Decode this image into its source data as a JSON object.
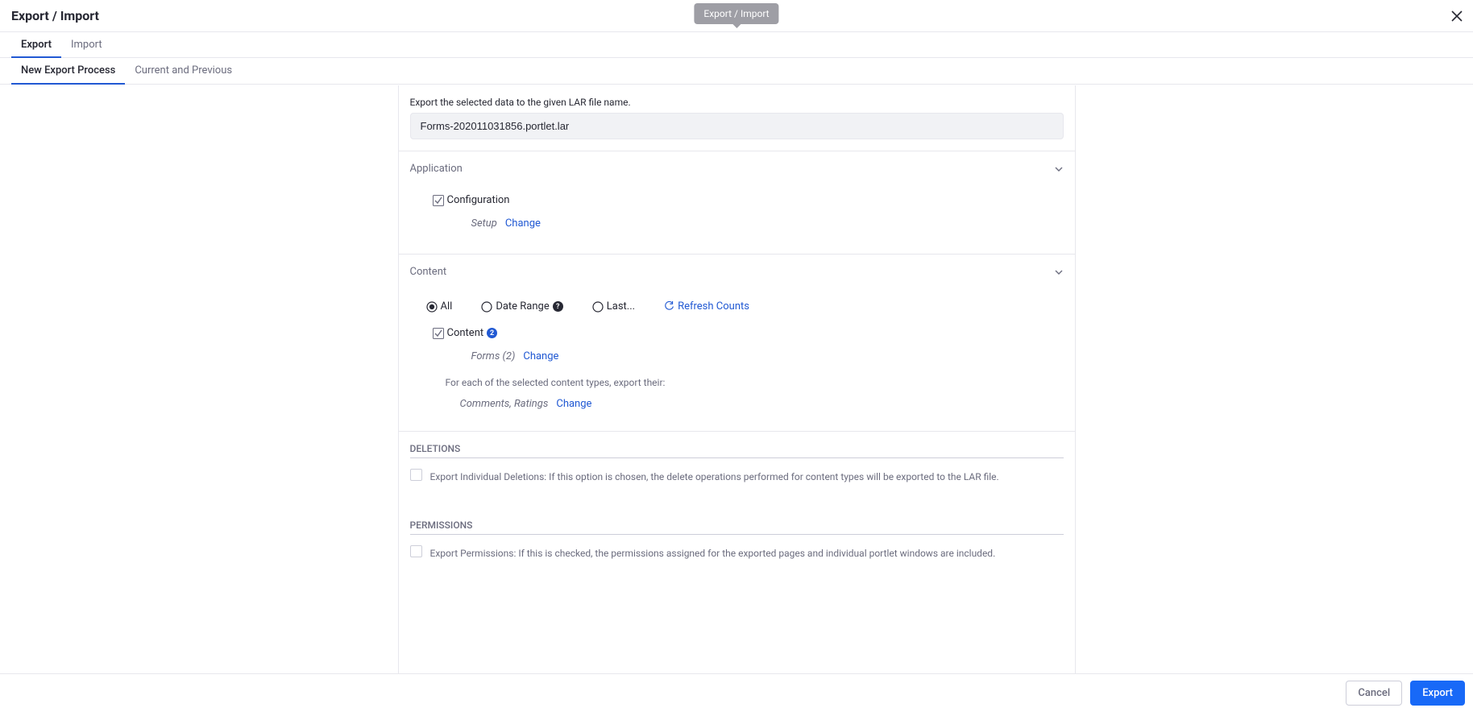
{
  "header": {
    "title": "Export / Import",
    "tooltip": "Export / Import"
  },
  "tabs1": {
    "export": "Export",
    "import": "Import"
  },
  "tabs2": {
    "new_process": "New Export Process",
    "current": "Current and Previous"
  },
  "top": {
    "desc": "Export the selected data to the given LAR file name.",
    "filename": "Forms-202011031856.portlet.lar"
  },
  "application": {
    "header": "Application",
    "configuration": "Configuration",
    "setup_label": "Setup",
    "change": "Change"
  },
  "content": {
    "header": "Content",
    "radio_all": "All",
    "radio_date": "Date Range",
    "radio_last": "Last...",
    "refresh": "Refresh Counts",
    "content_label": "Content",
    "content_count": "2",
    "forms_label": "Forms (2)",
    "change": "Change",
    "help": "For each of the selected content types, export their:",
    "comments": "Comments, Ratings",
    "change2": "Change",
    "info_badge": "?"
  },
  "deletions": {
    "header": "DELETIONS",
    "label": "Export Individual Deletions: If this option is chosen, the delete operations performed for content types will be exported to the LAR file."
  },
  "permissions": {
    "header": "PERMISSIONS",
    "label": "Export Permissions: If this is checked, the permissions assigned for the exported pages and individual portlet windows are included."
  },
  "footer": {
    "cancel": "Cancel",
    "export": "Export"
  }
}
